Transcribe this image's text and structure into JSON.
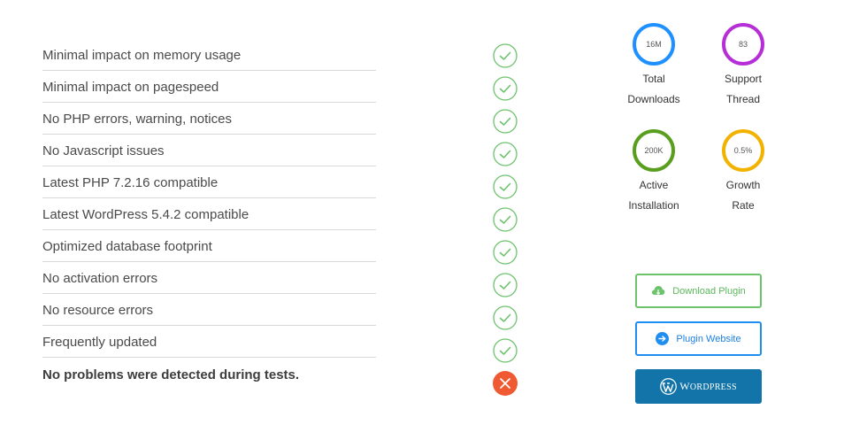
{
  "checklist": {
    "items": [
      {
        "label": "Minimal impact on memory usage",
        "status": "pass"
      },
      {
        "label": "Minimal impact on pagespeed",
        "status": "pass"
      },
      {
        "label": "No PHP errors, warning, notices",
        "status": "pass"
      },
      {
        "label": "No Javascript issues",
        "status": "pass"
      },
      {
        "label": "Latest PHP 7.2.16 compatible",
        "status": "pass"
      },
      {
        "label": "Latest WordPress 5.4.2 compatible",
        "status": "pass"
      },
      {
        "label": "Optimized database footprint",
        "status": "pass"
      },
      {
        "label": "No activation errors",
        "status": "pass"
      },
      {
        "label": "No resource errors",
        "status": "pass"
      },
      {
        "label": "Frequently updated",
        "status": "pass"
      }
    ],
    "summary": {
      "label": "No problems were detected during tests.",
      "status": "fail"
    }
  },
  "stats": [
    {
      "value": "16M",
      "label_line1": "Total",
      "label_line2": "Downloads",
      "color": "#1e90ff"
    },
    {
      "value": "83",
      "label_line1": "Support",
      "label_line2": "Thread",
      "color": "#b62fd6"
    },
    {
      "value": "200K",
      "label_line1": "Active",
      "label_line2": "Installation",
      "color": "#5a9e1f"
    },
    {
      "value": "0.5%",
      "label_line1": "Growth",
      "label_line2": "Rate",
      "color": "#f2b200"
    }
  ],
  "buttons": {
    "download": {
      "label": "Download Plugin",
      "icon": "cloud-download-icon"
    },
    "website": {
      "label": "Plugin Website",
      "icon": "arrow-right-circle-icon"
    },
    "wordpress": {
      "label_first": "W",
      "label_rest": "ORDPRESS",
      "icon": "wordpress-logo-icon"
    }
  },
  "colors": {
    "pass": "#6cc36c",
    "fail": "#f05a32"
  }
}
